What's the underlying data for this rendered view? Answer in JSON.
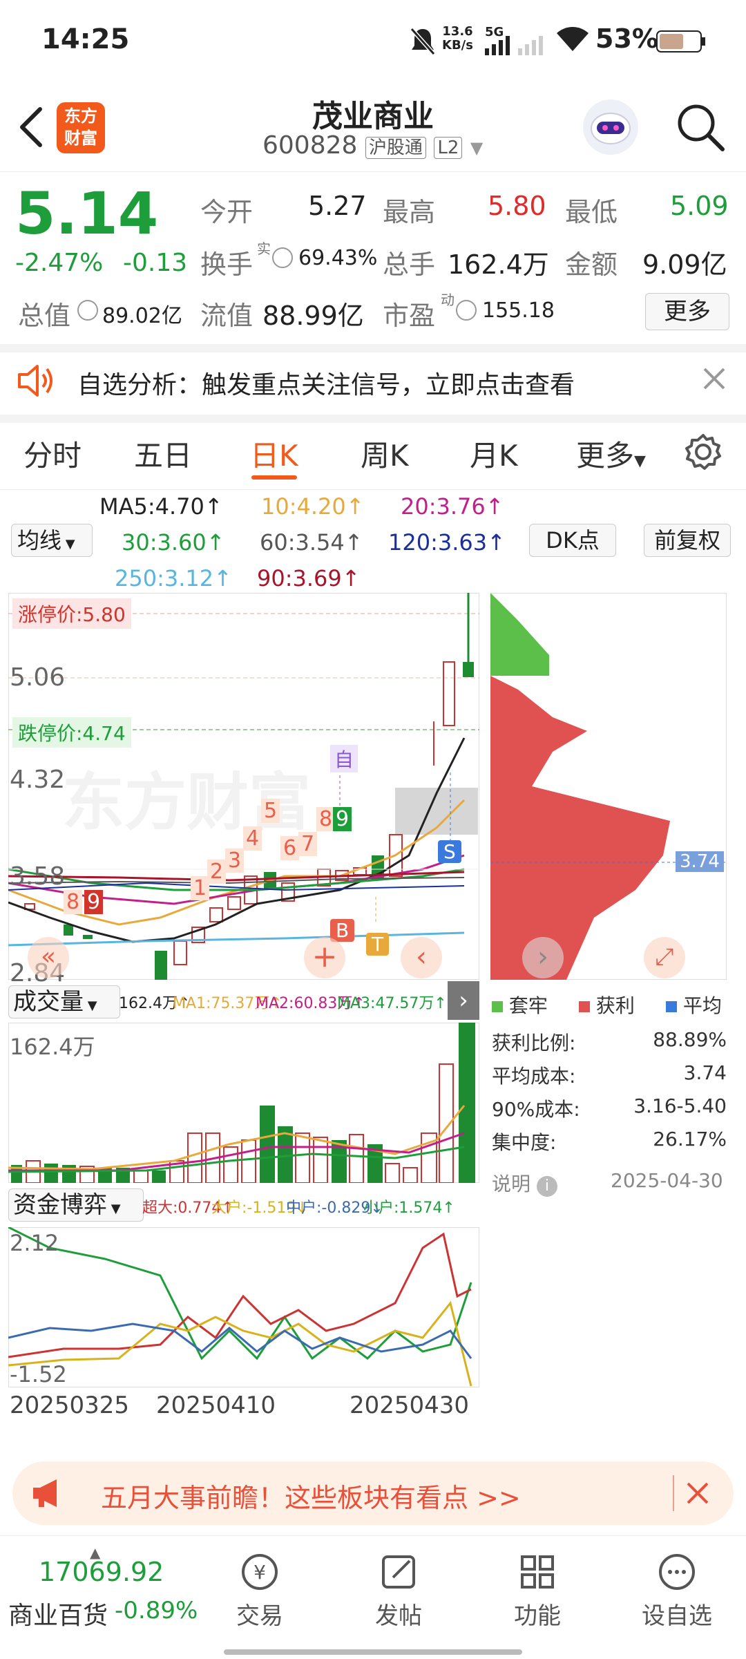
{
  "status": {
    "time": "14:25",
    "net_speed": "13.6",
    "net_unit": "KB/s",
    "net_type": "5G",
    "battery": "53%"
  },
  "header": {
    "app_logo": "东方\n财富",
    "stock_name": "茂业商业",
    "stock_code": "600828",
    "tag1": "沪股通",
    "tag2": "L2"
  },
  "quote": {
    "price": "5.14",
    "change_pct": "-2.47%",
    "change_abs": "-0.13",
    "open_label": "今开",
    "open": "5.27",
    "high_label": "最高",
    "high": "5.80",
    "low_label": "最低",
    "low": "5.09",
    "turnover_label": "换手",
    "turnover_sup": "实",
    "turnover": "69.43%",
    "volume_label": "总手",
    "volume": "162.4万",
    "amount_label": "金额",
    "amount": "9.09亿",
    "mktcap_label": "总值",
    "mktcap": "89.02亿",
    "float_label": "流值",
    "float": "88.99亿",
    "pe_label": "市盈",
    "pe_sup": "动",
    "pe": "155.18",
    "more_button": "更多"
  },
  "notice": {
    "text": "自选分析：触发重点关注信号，立即点击查看"
  },
  "tabs": {
    "items": [
      "分时",
      "五日",
      "日K",
      "周K",
      "月K",
      "更多"
    ],
    "active": "日K"
  },
  "ma_legend": {
    "ma5": "MA5:4.70↑",
    "ma10": "10:4.20↑",
    "ma20": "20:3.76↑",
    "ma30": "30:3.60↑",
    "ma60": "60:3.54↑",
    "ma120": "120:3.63↑",
    "ma250": "250:3.12↑",
    "ma90": "90:3.69↑",
    "ma_select": "均线",
    "dk_button": "DK点",
    "fq_button": "前复权"
  },
  "kline": {
    "limit_up": "涨停价:5.80",
    "limit_down": "跌停价:4.74",
    "y_labels": [
      "5.06",
      "4.32",
      "3.58",
      "2.84"
    ],
    "signal_zi": "自",
    "signal_s": "S",
    "signal_b": "B",
    "signal_t": "T",
    "watermark": "东方财富",
    "seq_counts": [
      "1",
      "2",
      "3",
      "4",
      "5",
      "6",
      "7",
      "8",
      "9"
    ]
  },
  "chip": {
    "avg_marker": "3.74",
    "legend": [
      "套牢",
      "获利",
      "平均"
    ],
    "rows": [
      {
        "label": "获利比例:",
        "value": "88.89%"
      },
      {
        "label": "平均成本:",
        "value": "3.74"
      },
      {
        "label": "90%成本:",
        "value": "3.16-5.40"
      },
      {
        "label": "集中度:",
        "value": "26.17%"
      }
    ],
    "note_label": "说明",
    "date": "2025-04-30"
  },
  "volume": {
    "select": "成交量",
    "legend": [
      "162.4万↑",
      "MA1:75.37万↑",
      "MA2:60.83万↑",
      "MA3:47.57万↑"
    ],
    "max_label": "162.4万"
  },
  "capital": {
    "select": "资金博弈",
    "legend": [
      "超大:0.774↑",
      "大户:-1.519↓",
      "中户:-0.829↓",
      "小户:1.574↑"
    ],
    "top": "2.12",
    "bottom": "-1.52"
  },
  "dates": [
    "20250325",
    "20250410",
    "20250430"
  ],
  "banner": {
    "text": "五月大事前瞻！这些板块有看点 >>"
  },
  "bottom": {
    "index_value": "17069.92",
    "index_name": "商业百货",
    "index_change": "-0.89%",
    "nav": [
      "交易",
      "发帖",
      "功能",
      "设自选"
    ]
  }
}
